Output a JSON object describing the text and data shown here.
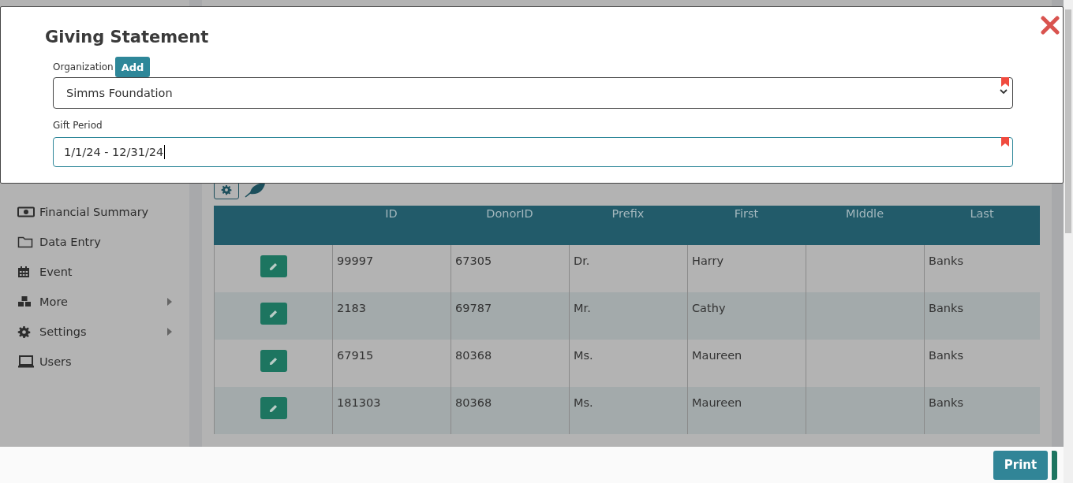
{
  "sidebar": {
    "items": [
      {
        "label": "Financial Summary",
        "expandable": false
      },
      {
        "label": "Data Entry",
        "expandable": false
      },
      {
        "label": "Event",
        "expandable": false
      },
      {
        "label": "More",
        "expandable": true
      },
      {
        "label": "Settings",
        "expandable": true
      },
      {
        "label": "Users",
        "expandable": false
      }
    ]
  },
  "table": {
    "columns": [
      "ID",
      "DonorID",
      "Prefix",
      "First",
      "MIddle",
      "Last"
    ],
    "rows": [
      {
        "cells": [
          "99997",
          "67305",
          "Dr.",
          "Harry",
          null,
          "Banks"
        ]
      },
      {
        "cells": [
          "2183",
          "69787",
          "Mr.",
          "Cathy",
          null,
          "Banks"
        ]
      },
      {
        "cells": [
          "67915",
          "80368",
          "Ms.",
          "Maureen",
          null,
          "Banks"
        ]
      },
      {
        "cells": [
          "181303",
          "80368",
          "Ms.",
          "Maureen",
          null,
          "Banks"
        ]
      }
    ]
  },
  "modal": {
    "title": "Giving Statement",
    "fields": [
      {
        "kind": "select",
        "label": "Organization",
        "button": "Add",
        "value": "Simms Foundation",
        "required": true
      },
      {
        "kind": "text",
        "label": "Gift Period",
        "value": "1/1/24 - 12/31/24",
        "required": true
      }
    ]
  },
  "footer": {
    "buttons": [
      "Print"
    ]
  }
}
